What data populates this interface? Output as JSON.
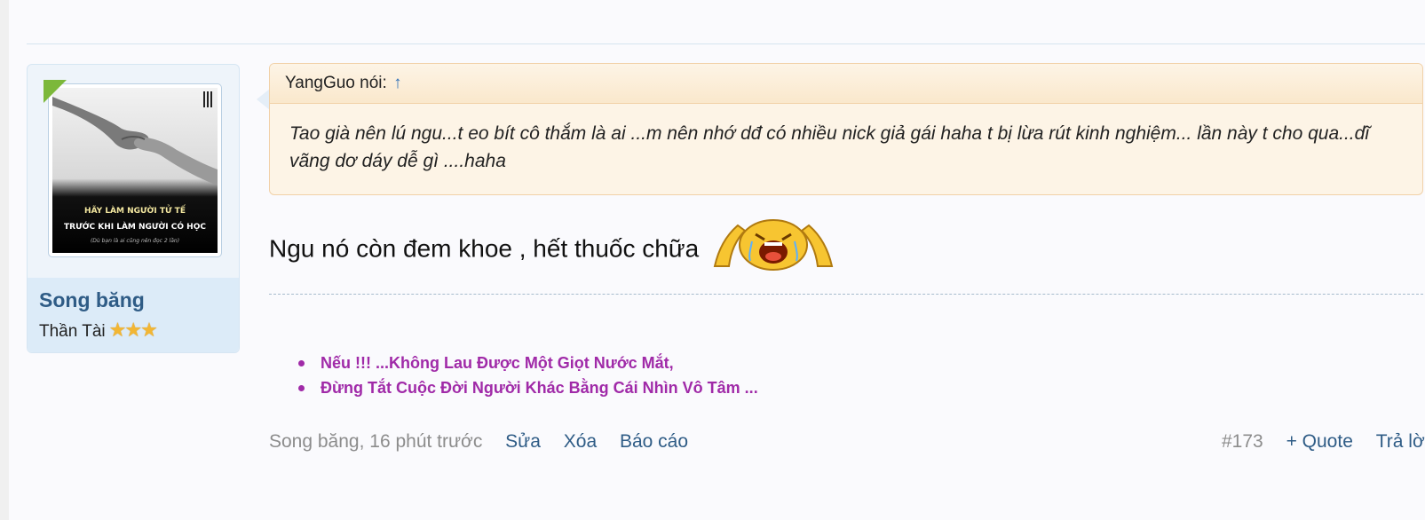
{
  "quote": {
    "author_label": "YangGuo nói:",
    "jump_icon": "↑",
    "text": "Tao già nên lú ngu...t eo bít cô thắm là ai ...m nên nhớ dđ có nhiều nick giả gái haha t bị lừa rút kinh nghiệm... lần này t cho qua...dĩ vãng dơ dáy dễ gì ....haha"
  },
  "user": {
    "name": "Song băng",
    "title": "Thần Tài",
    "stars": "★★★",
    "avatar_text": {
      "line1": "HÃY LÀM NGƯỜI TỬ TẾ",
      "line2": "TRƯỚC KHI LÀM NGƯỜI CÓ HỌC",
      "line3": "(Dù bạn là ai cũng nên đọc 2 lần)"
    }
  },
  "message": {
    "text": "Ngu nó còn đem khoe , hết thuốc chữa",
    "emoji": "crying-emoji-icon"
  },
  "signature": {
    "items": [
      "Nếu !!! ...Không Lau Được Một Giọt Nước Mắt,",
      "Đừng Tắt Cuộc Đời Người Khác Bằng Cái Nhìn Vô Tâm ..."
    ]
  },
  "footer": {
    "meta": "Song băng, 16 phút trước",
    "edit": "Sửa",
    "delete": "Xóa",
    "report": "Báo cáo",
    "post_number": "#173",
    "quote": "+ Quote",
    "reply": "Trả lời"
  },
  "colors": {
    "username": "#2f5c86",
    "signature": "#a02aa8",
    "quote_bg": "#fdf4e6"
  }
}
